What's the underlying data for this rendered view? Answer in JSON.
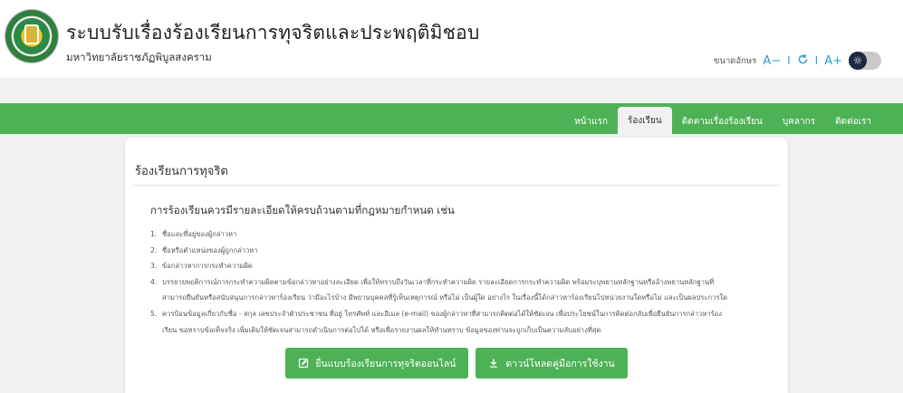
{
  "header": {
    "title": "ระบบรับเรื่องร้องเรียนการทุจริตและประพฤติมิชอบ",
    "subtitle": "มหาวิทยาลัยราชภัฏพิบูลสงคราม"
  },
  "accessibility": {
    "font_size_label": "ขนาดอักษร",
    "decrease_label": "A−",
    "reset_icon": "refresh-icon",
    "increase_label": "A+",
    "separator": "I",
    "theme_icon": "sun-icon"
  },
  "nav": {
    "items": [
      {
        "label": "หน้าแรก",
        "active": false
      },
      {
        "label": "ร้องเรียน",
        "active": true
      },
      {
        "label": "ติดตามเรื่องร้องเรียน",
        "active": false
      },
      {
        "label": "บุคลากร",
        "active": false
      },
      {
        "label": "ติดต่อเรา",
        "active": false
      }
    ]
  },
  "card": {
    "title": "ร้องเรียนการทุจริต",
    "lead": "การร้องเรียนควรมีรายละเอียดให้ครบถ้วนตามที่กฎหมายกำหนด เช่น",
    "items": [
      {
        "num": "1.",
        "text": "ชื่อและที่อยู่ของผู้กล่าวหา"
      },
      {
        "num": "2.",
        "text": "ชื่อหรือตำแหน่งของผู้ถูกกล่าวหา"
      },
      {
        "num": "3.",
        "text": "ข้อกล่าวหาการกระทำความผิด"
      },
      {
        "num": "4.",
        "text": "บรรยายพฤติการณ์การกระทำความผิดตามข้อกล่าวหาอย่างละเอียด เพื่อให้ทราบถึงวันเวลาที่กระทำความผิด รายละเอียดการกระทำความผิด พร้อมระบุพยานหลักฐานหรืออ้างพยานหลักฐานที่"
      },
      {
        "num": "",
        "text": "สามารถยืนยันหรือสนับสนุนการกล่าวหาร้องเรียน ว่ามีอะไรบ้าง มีพยานบุคคลที่รู้เห็นเหตุการณ์ หรือไม่ เป็นผู้ใด อย่างไร ในเรื่องนี้ได้กล่าวหาร้องเรียนไปหน่วยงานใดหรือไม่ และเป็นผลประการใด"
      },
      {
        "num": "5.",
        "text": "ควรป้อนข้อมูลเกี่ยวกับชื่อ - สกุล เลขประจำตัวประชาชน ที่อยู่ โทรศัพท์ และอีเมล (e-mail) ของผู้กล่าวหาที่สามารถติดต่อได้ให้ชัดเจน เพื่อประโยชน์ในการติดต่อกลับเพื่อยืนยันการกล่าวหาร้อง"
      },
      {
        "num": "",
        "text": "เรียน ขอทราบข้อเท็จจริง เพิ่มเติมให้ชัดเจนสามารถดำเนินการต่อไปได้ หรือเพื่อรายงานผลให้ทำนทราบ ข้อมูลของท่านจะถูกเก็บเป็นความลับอย่างที่สุด"
      }
    ],
    "buttons": {
      "online_label": "ยื่นแบบร้องเรียนการทุจริตออนไลน์",
      "online_icon": "form-icon",
      "download_label": "ดาวน์โหลดคู่มือการใช้งาน",
      "download_icon": "download-icon"
    }
  },
  "colors": {
    "accent_green": "#4db256",
    "link_blue": "#2f9bd5",
    "background": "#f1f1f1"
  }
}
